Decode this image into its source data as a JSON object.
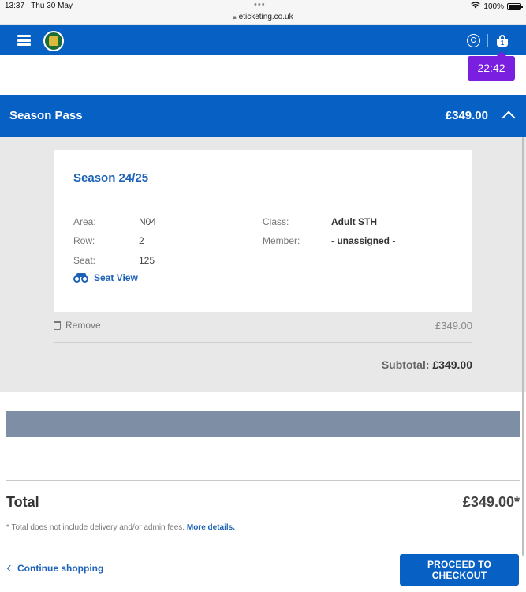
{
  "status_bar": {
    "time": "13:37",
    "date": "Thu 30 May",
    "dots": "•••",
    "url": "eticketing.co.uk",
    "wifi_icon": "wifi-icon",
    "battery": "100%"
  },
  "header": {
    "menu_icon": "hamburger-icon",
    "logo_icon": "club-crest-logo",
    "account_icon": "user-icon",
    "basket_icon": "basket-icon",
    "basket_count": "1",
    "timer": "22:42"
  },
  "season_pass": {
    "title": "Season Pass",
    "price": "£349.00",
    "card": {
      "title": "Season 24/25",
      "area_label": "Area:",
      "area_value": "N04",
      "row_label": "Row:",
      "row_value": "2",
      "seat_label": "Seat:",
      "seat_value": "125",
      "class_label": "Class:",
      "class_value": "Adult STH",
      "member_label": "Member:",
      "member_value": "- unassigned -",
      "seat_view_label": "Seat View"
    },
    "remove_label": "Remove",
    "line_price": "£349.00",
    "subtotal_label": "Subtotal:",
    "subtotal_value": "£349.00"
  },
  "summary": {
    "total_label": "Total",
    "total_value": "£349.00*",
    "note": "* Total does not include delivery and/or admin fees.",
    "more_details": "More details."
  },
  "footer": {
    "continue_label": "Continue shopping",
    "checkout_label": "PROCEED TO CHECKOUT"
  },
  "colors": {
    "brand_blue": "#0760c4",
    "timer_purple": "#7a1fe0",
    "slate": "#7d8ea5"
  }
}
